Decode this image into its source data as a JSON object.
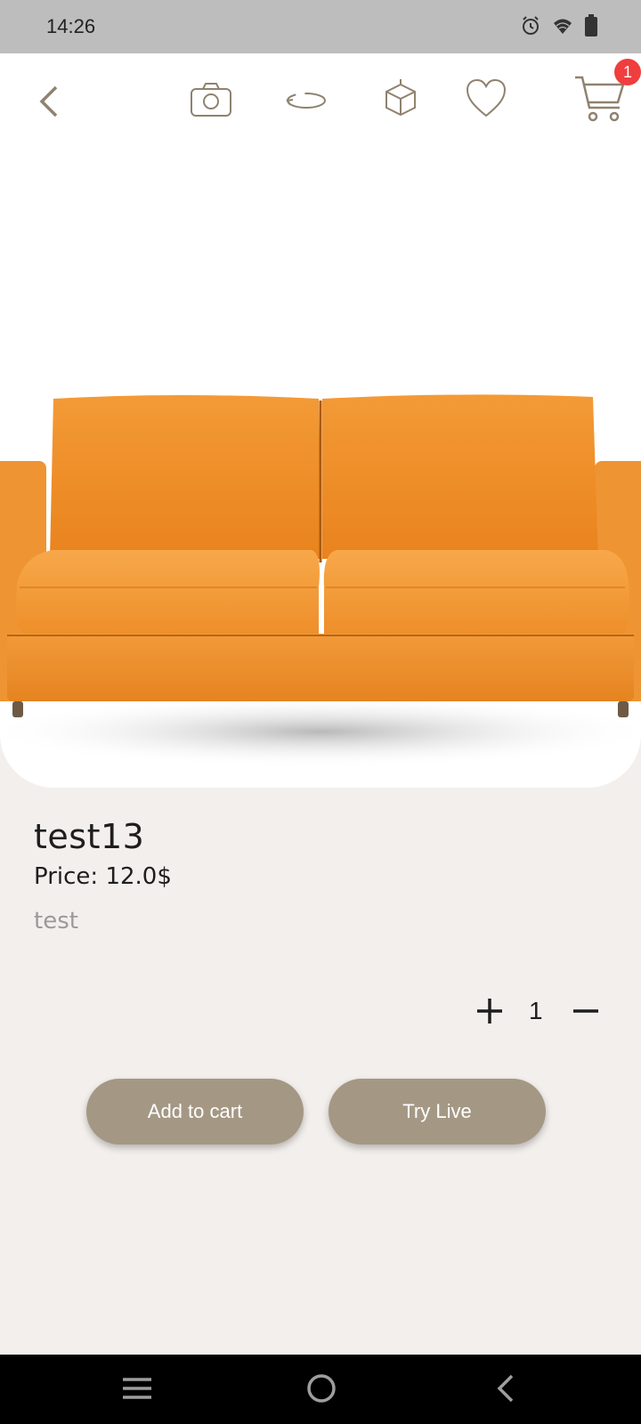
{
  "status_bar": {
    "time": "14:26",
    "icons": [
      "alarm-icon",
      "wifi-icon",
      "battery-icon"
    ]
  },
  "toolbar": {
    "icons": [
      "back-chevron-icon",
      "camera-icon",
      "rotate-360-icon",
      "ar-cube-icon",
      "heart-icon",
      "cart-icon"
    ],
    "cart_badge": "1"
  },
  "product": {
    "name": "test13",
    "price": "Price: 12.0$",
    "description": "test",
    "image": "orange-sofa"
  },
  "quantity": {
    "value": "1"
  },
  "actions": {
    "add_to_cart": "Add to cart",
    "try_live": "Try Live"
  },
  "nav": {
    "icons": [
      "menu-icon",
      "home-icon",
      "back-icon"
    ]
  },
  "colors": {
    "accent": "#a49885",
    "icon": "#8f826f",
    "badge": "#f03d3d",
    "background": "#f3efec",
    "sofa": "#f08f2a"
  }
}
